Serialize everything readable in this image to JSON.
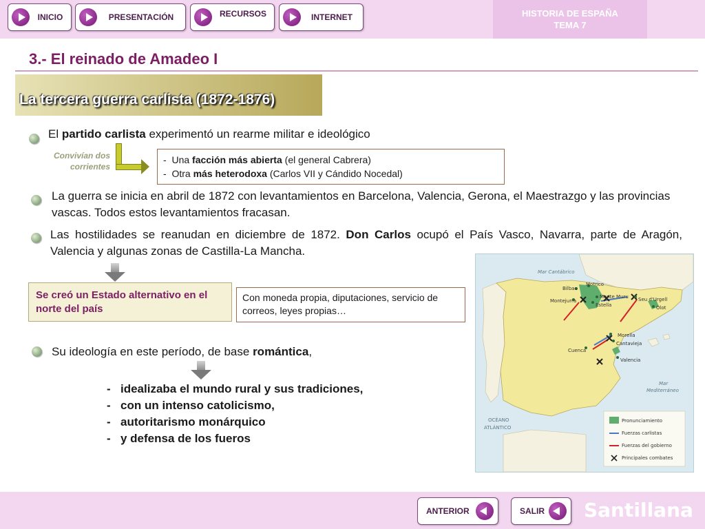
{
  "nav": {
    "buttons": [
      {
        "label": "INICIO"
      },
      {
        "label": "PRESENTACIÓN"
      },
      {
        "label": "RECURSOS"
      },
      {
        "label": "INTERNET"
      }
    ],
    "tema_line1": "HISTORIA DE ESPAÑA",
    "tema_line2": "TEMA 7"
  },
  "title": "3.- El reinado de Amadeo I",
  "subtitle": "La tercera guerra carlista (1872-1876)",
  "p1": {
    "pre": "El ",
    "bold": "partido carlista",
    "post": " experimentó un rearme militar e ideológico"
  },
  "conv_line1": "Convivían dos",
  "conv_line2": "corrientes",
  "factions": [
    {
      "pre": "Una ",
      "bold": "facción más abierta",
      "post": " (el general Cabrera)"
    },
    {
      "pre": "Otra ",
      "bold": "más heterodoxa",
      "post": " (Carlos VII y Cándido Nocedal)"
    }
  ],
  "p2": "La guerra se inicia en abril de 1872 con levantamientos en Barcelona, Valencia, Gerona, el Maestrazgo y las provincias vascas. Todos estos levantamientos fracasan.",
  "p3": {
    "pre": "Las hostilidades se reanudan en diciembre de 1872. ",
    "bold": "Don Carlos",
    "post": " ocupó el País Vasco, Navarra, parte de Aragón, Valencia y algunas zonas de Castilla-La Mancha."
  },
  "estado": "Se creó un Estado alternativo en el norte del país",
  "estado_detail": "Con moneda propia, diputaciones, servicio de correos, leyes propias…",
  "p4": {
    "pre": "Su ideología en este período, de base ",
    "bold": "romántica",
    "post": ","
  },
  "traits": [
    "idealizaba el mundo rural y sus tradiciones,",
    "con un intenso catolicismo,",
    "autoritarismo monárquico",
    "y defensa de los fueros"
  ],
  "map": {
    "sea_north": "Mar Cantábrico",
    "sea_med_1": "Mar",
    "sea_med_2": "Mediterráneo",
    "ocean_1": "OCÉANO",
    "ocean_2": "ATLÁNTICO",
    "places": {
      "bilbao": "Bilbao",
      "motrico": "Motrico",
      "montejurra": "Montejurra",
      "monte_muru": "Monte Muru",
      "estella": "Estella",
      "seu": "Seu d'Urgell",
      "olot": "Olot",
      "morella": "Morella",
      "cantavieja": "Cantavieja",
      "cuenca": "Cuenca",
      "valencia": "Valencia"
    },
    "legend": [
      {
        "label": "Pronunciamiento",
        "color": "#5fae6e"
      },
      {
        "label": "Fuerzas carlistas",
        "color": "#4a78c8"
      },
      {
        "label": "Fuerzas del gobierno",
        "color": "#d3202a"
      },
      {
        "label": "Principales combates",
        "color": "#222222"
      }
    ]
  },
  "footer": {
    "prev": "ANTERIOR",
    "exit": "SALIR",
    "brand": "Santillana"
  }
}
